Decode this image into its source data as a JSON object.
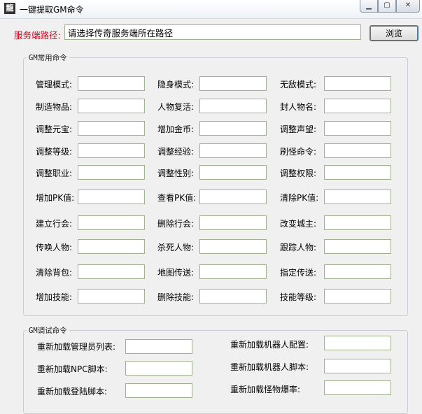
{
  "window": {
    "title": "一键提取GM命令",
    "icon_text": "龍"
  },
  "server_path": {
    "label": "服务端路径:",
    "placeholder": "请选择传奇服务端所在路径",
    "browse_label": "浏览"
  },
  "gm_common": {
    "title": "GM常用命令",
    "rows": [
      [
        "管理模式:",
        "隐身模式:",
        "无敌模式:"
      ],
      [
        "制造物品:",
        "人物复活:",
        "封人物名:"
      ],
      [
        "调整元宝:",
        "增加金币:",
        "调整声望:"
      ],
      [
        "调整等级:",
        "调整经验:",
        "刷怪命令:"
      ],
      [
        "调整职业:",
        "调整性别:",
        "调整权限:"
      ],
      [
        "增加PK值:",
        "查看PK值:",
        "清除PK值:"
      ],
      [
        "建立行会:",
        "删除行会:",
        "改变城主:"
      ],
      [
        "传唤人物:",
        "杀死人物:",
        "跟踪人物:"
      ],
      [
        "清除背包:",
        "地图传送:",
        "指定传送:"
      ],
      [
        "增加技能:",
        "删除技能:",
        "技能等级:"
      ]
    ]
  },
  "gm_debug": {
    "title": "GM调试命令",
    "rows": [
      [
        "重新加载管理员列表:",
        "重新加载机器人配置:"
      ],
      [
        "重新加载NPC脚本:",
        "重新加载机器人脚本:"
      ],
      [
        "重新加载登陆脚本:",
        "重新加载怪物爆率:"
      ]
    ]
  }
}
